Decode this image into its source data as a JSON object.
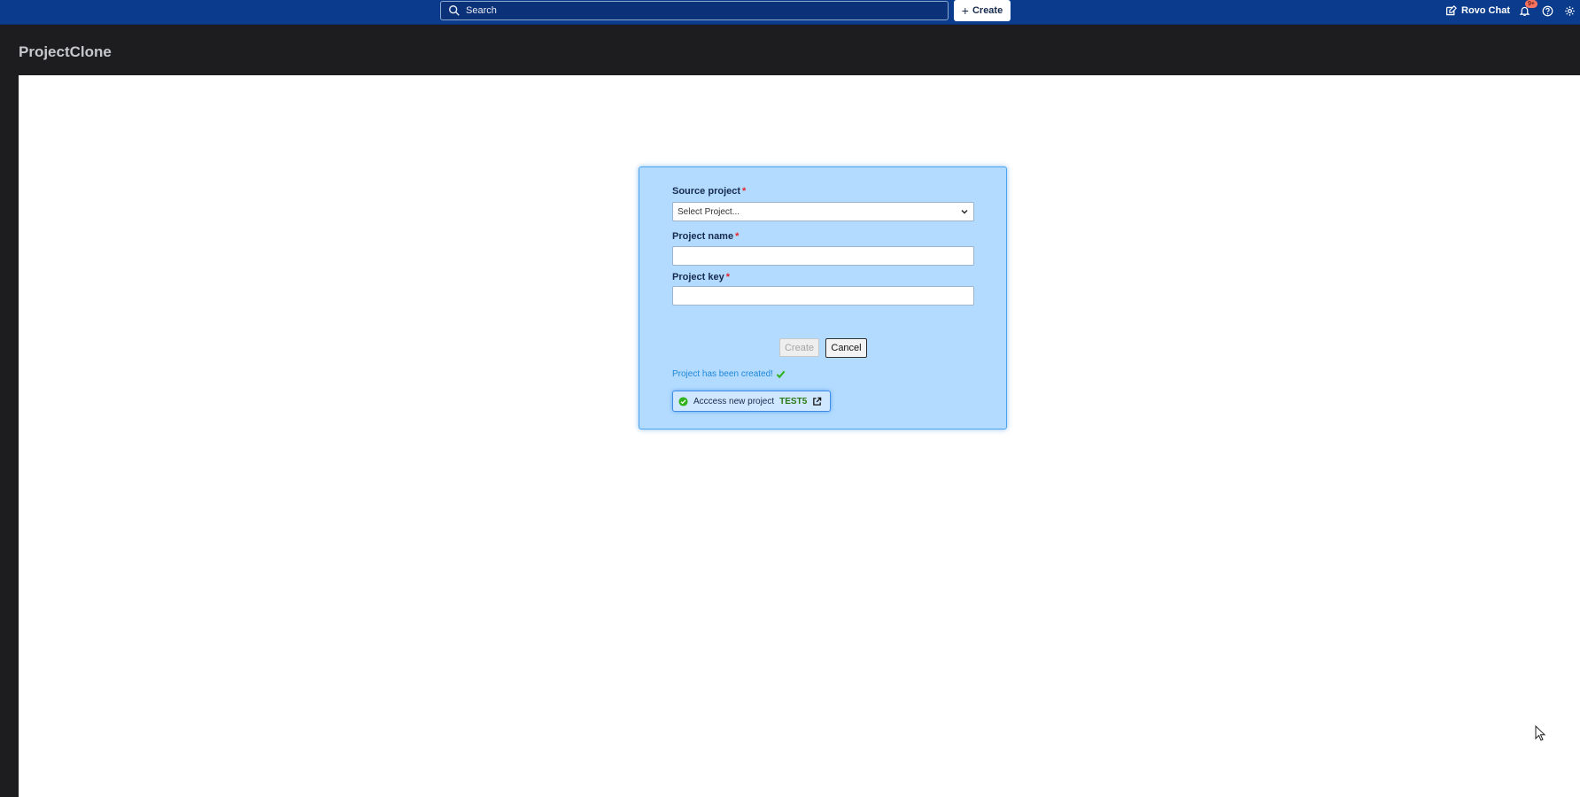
{
  "topbar": {
    "search_placeholder": "Search",
    "create_label": "Create",
    "rovo_label": "Rovo Chat",
    "notification_badge": "9+"
  },
  "app": {
    "title": "ProjectClone"
  },
  "form": {
    "source_label": "Source project",
    "source_value": "Select Project...",
    "name_label": "Project name",
    "key_label": "Project key",
    "required_mark": "*",
    "create_button": "Create",
    "cancel_button": "Cancel",
    "success_message": "Project has been created!",
    "access_label": "Acccess new project",
    "access_key": "TEST5"
  },
  "colors": {
    "topbar": "#0a3b8c",
    "panel": "#b3dbff",
    "success": "#1f87d6",
    "check": "#2fb21b"
  }
}
